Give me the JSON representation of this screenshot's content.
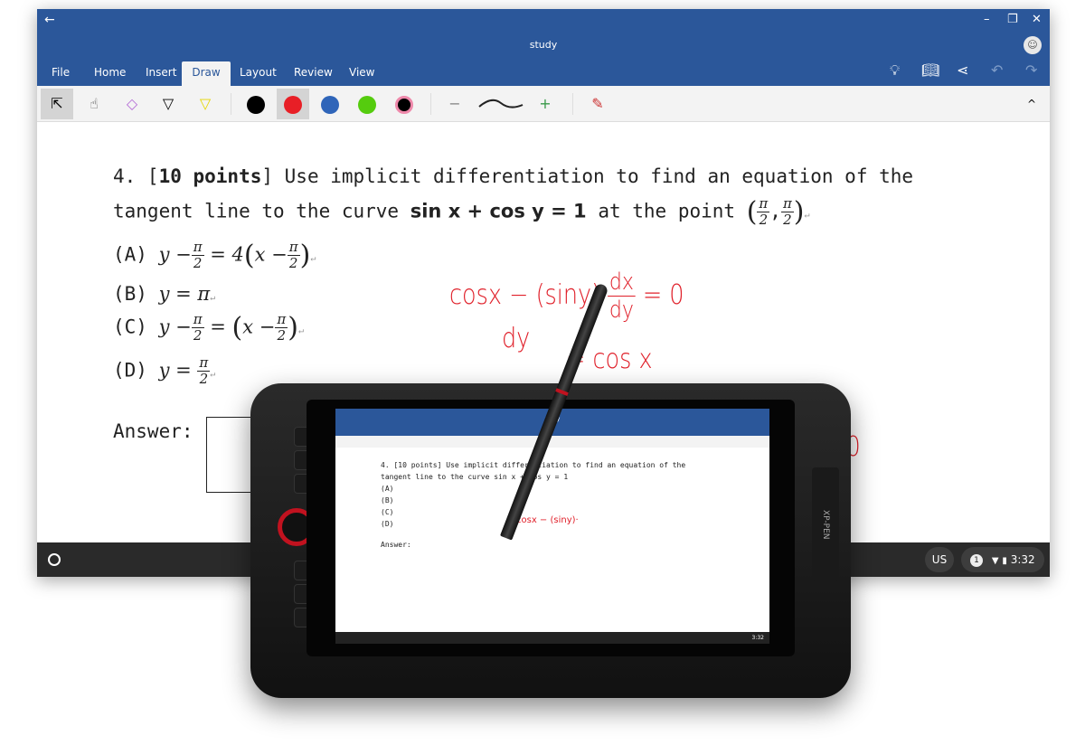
{
  "window": {
    "title": "study",
    "back": "←",
    "minimize": "–",
    "restore": "❐",
    "close": "✕",
    "avatar": "☺"
  },
  "tabs": [
    {
      "label": "File"
    },
    {
      "label": "Home"
    },
    {
      "label": "Insert"
    },
    {
      "label": "Draw",
      "active": true
    },
    {
      "label": "Layout"
    },
    {
      "label": "Review"
    },
    {
      "label": "View"
    }
  ],
  "right_icons": [
    "lightbulb-icon",
    "book-icon",
    "share-icon",
    "undo-icon",
    "redo-icon"
  ],
  "toolbar": {
    "tools": [
      "select",
      "touch-draw",
      "eraser",
      "pen",
      "highlighter"
    ],
    "colors": [
      "#000000",
      "#e81f26",
      "#2f65b9",
      "#55cc0e"
    ],
    "selected_color": "#e81f26",
    "thickness_minus": "−",
    "thickness_plus": "+",
    "collapse": "^"
  },
  "document": {
    "q1": "4. [",
    "q_bold": "10 points",
    "q2": "] Use implicit differentiation to find an equation of the",
    "q3": "tangent line to the curve",
    "curve": "sin x + cos y = 1",
    "q4": "at the point",
    "pi": "π",
    "two": "2",
    "a": "(A)",
    "b": "(B)",
    "c": "(C)",
    "d": "(D)",
    "answer": "Answer:",
    "para": "↵"
  },
  "ink": {
    "l1": "cosx − (siny)·",
    "dx": "dx",
    "dy": "dy",
    "eq0": "= 0",
    "l2": "dy",
    "l3": "=  cos x",
    "l4": "= 0"
  },
  "taskbar": {
    "ime": "US",
    "notifications": "1",
    "time": "3:32"
  },
  "tablet": {
    "brand": "XP-PEN"
  }
}
